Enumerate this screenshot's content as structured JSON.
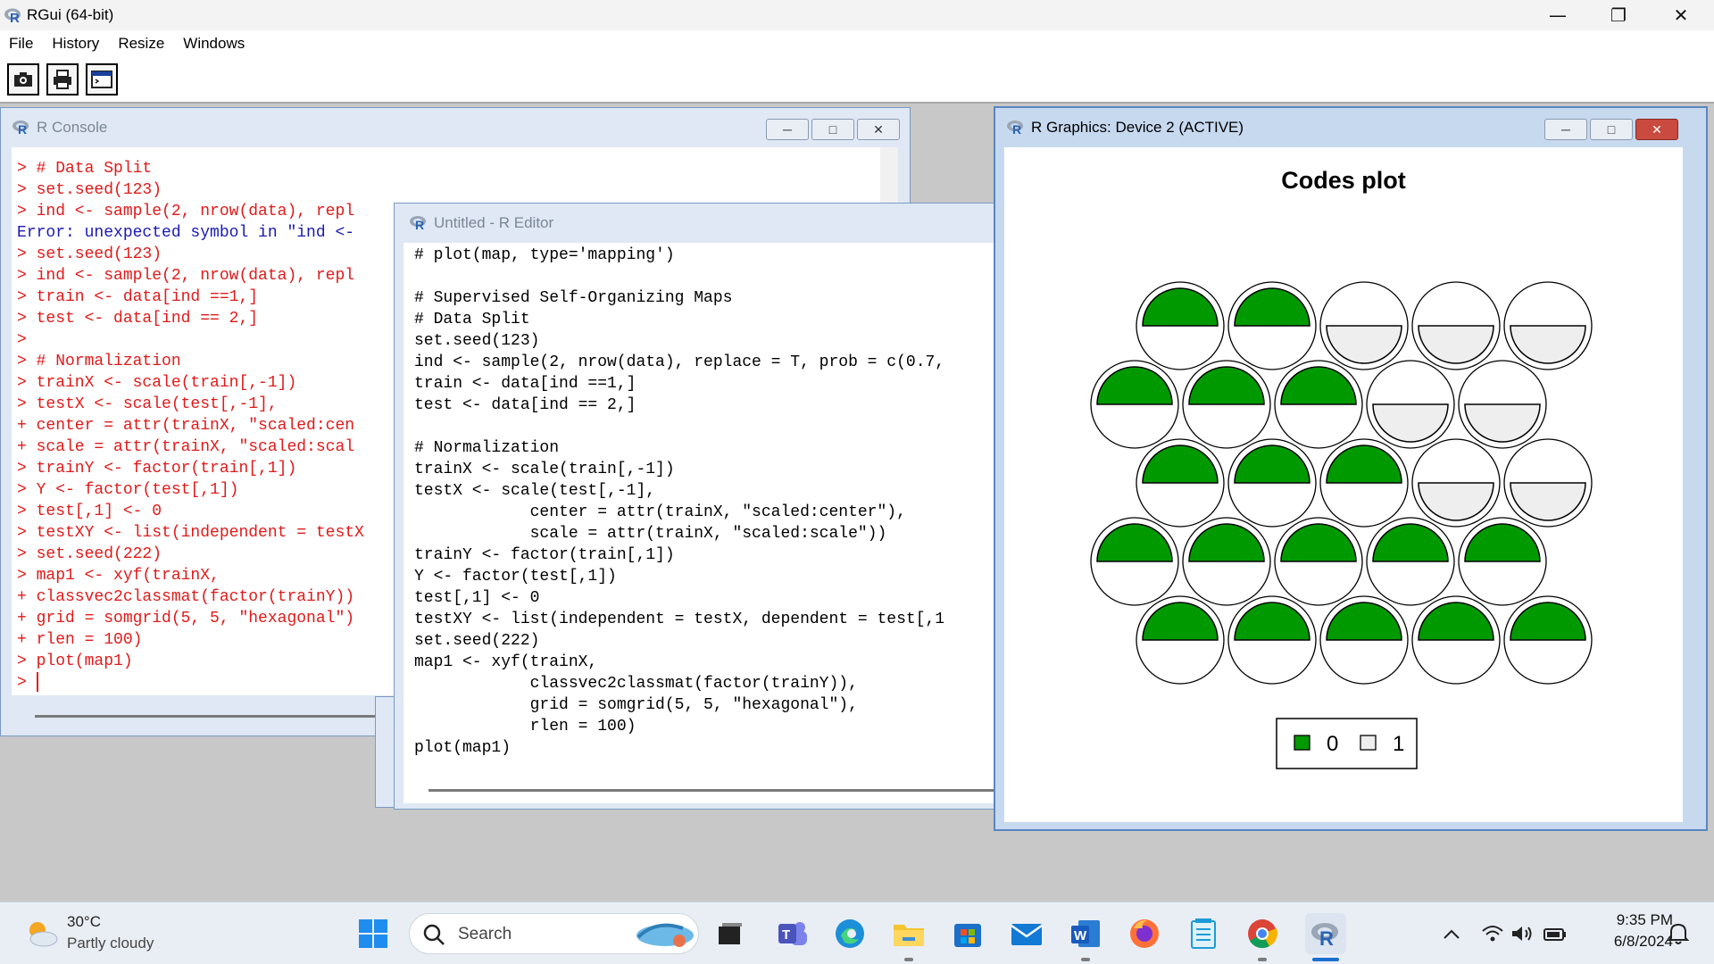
{
  "app": {
    "title": "RGui (64-bit)",
    "menu": [
      "File",
      "History",
      "Resize",
      "Windows"
    ],
    "toolbar_icons": [
      "camera-icon",
      "printer-icon",
      "console-window-icon"
    ]
  },
  "console": {
    "title": "R Console",
    "lines": [
      {
        "text": "> # Data Split",
        "color": "red"
      },
      {
        "text": "> set.seed(123)",
        "color": "red"
      },
      {
        "text": "> ind <- sample(2, nrow(data), repl",
        "color": "red"
      },
      {
        "text": "Error: unexpected symbol in \"ind <-",
        "color": "blue"
      },
      {
        "text": "> set.seed(123)",
        "color": "red"
      },
      {
        "text": "> ind <- sample(2, nrow(data), repl",
        "color": "red"
      },
      {
        "text": "> train <- data[ind ==1,]",
        "color": "red"
      },
      {
        "text": "> test <- data[ind == 2,]",
        "color": "red"
      },
      {
        "text": ">",
        "color": "red"
      },
      {
        "text": "> # Normalization",
        "color": "red"
      },
      {
        "text": "> trainX <- scale(train[,-1])",
        "color": "red"
      },
      {
        "text": "> testX <- scale(test[,-1],",
        "color": "red"
      },
      {
        "text": "+ center = attr(trainX, \"scaled:cen",
        "color": "red"
      },
      {
        "text": "+ scale = attr(trainX, \"scaled:scal",
        "color": "red"
      },
      {
        "text": "> trainY <- factor(train[,1])",
        "color": "red"
      },
      {
        "text": "> Y <- factor(test[,1])",
        "color": "red"
      },
      {
        "text": "> test[,1] <- 0",
        "color": "red"
      },
      {
        "text": "> testXY <- list(independent = testX",
        "color": "red"
      },
      {
        "text": "> set.seed(222)",
        "color": "red"
      },
      {
        "text": "> map1 <- xyf(trainX,",
        "color": "red"
      },
      {
        "text": "+ classvec2classmat(factor(trainY))",
        "color": "red"
      },
      {
        "text": "+ grid = somgrid(5, 5, \"hexagonal\")",
        "color": "red"
      },
      {
        "text": "+ rlen = 100)",
        "color": "red"
      },
      {
        "text": "> plot(map1)",
        "color": "red"
      },
      {
        "text": "> ",
        "color": "red"
      }
    ]
  },
  "editor": {
    "title": "Untitled - R Editor",
    "lines": [
      "# plot(map, type='mapping')",
      "",
      "# Supervised Self-Organizing Maps",
      "# Data Split",
      "set.seed(123)",
      "ind <- sample(2, nrow(data), replace = T, prob = c(0.7,",
      "train <- data[ind ==1,]",
      "test <- data[ind == 2,]",
      "",
      "# Normalization",
      "trainX <- scale(train[,-1])",
      "testX <- scale(test[,-1],",
      "            center = attr(trainX, \"scaled:center\"),",
      "            scale = attr(trainX, \"scaled:scale\"))",
      "trainY <- factor(train[,1])",
      "Y <- factor(test[,1])",
      "test[,1] <- 0",
      "testXY <- list(independent = testX, dependent = test[,1",
      "set.seed(222)",
      "map1 <- xyf(trainX,",
      "            classvec2classmat(factor(trainY)),",
      "            grid = somgrid(5, 5, \"hexagonal\"),",
      "            rlen = 100)",
      "plot(map1)"
    ]
  },
  "graphics": {
    "title": "R Graphics: Device 2 (ACTIVE)",
    "plot_title": "Codes plot",
    "legend": [
      {
        "label": "0",
        "color": "#009a00"
      },
      {
        "label": "1",
        "color": "#eeeeee"
      }
    ],
    "rows": [
      [
        "0",
        "0",
        "1",
        "1",
        "1"
      ],
      [
        "0",
        "0",
        "0",
        "1",
        "1"
      ],
      [
        "0",
        "0",
        "0",
        "1",
        "1"
      ],
      [
        "0",
        "0",
        "0",
        "0",
        "0"
      ],
      [
        "0",
        "0",
        "0",
        "0",
        "0"
      ]
    ]
  },
  "colors": {
    "green": "#009a00",
    "grey": "#eeeeee",
    "console_red": "#e01a1a",
    "console_blue": "#1a1ab5"
  },
  "taskbar": {
    "weather_temp": "30°C",
    "weather_desc": "Partly cloudy",
    "search_placeholder": "Search",
    "time": "9:35 PM",
    "date": "6/8/2024"
  }
}
